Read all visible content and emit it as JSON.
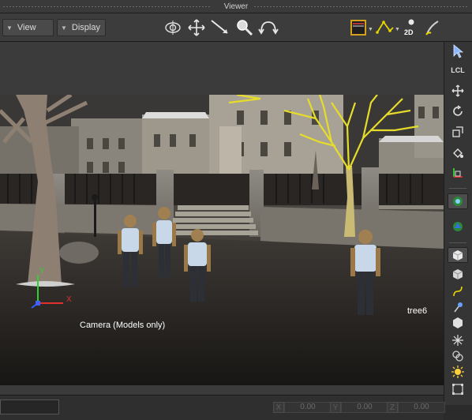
{
  "window": {
    "title": "Viewer"
  },
  "toolbar": {
    "view_menu": "View",
    "display_menu": "Display",
    "icons": [
      "orbit-icon",
      "pan-icon",
      "dolly-icon",
      "zoom-icon",
      "undo-camera-icon",
      "safe-area-icon",
      "curve-icon",
      "2d-view-icon",
      "brush-icon"
    ],
    "label_2d": "2D"
  },
  "viewport": {
    "camera_label": "Camera (Models only)",
    "selected_object_label": "tree6",
    "axis": {
      "x": "X",
      "y": "Y"
    }
  },
  "right_toolbar": {
    "icons": [
      "select-arrow-icon",
      "local-mode-icon",
      "move-icon",
      "rotate-icon",
      "scale-icon",
      "paint-bucket-icon",
      "translate-gizmo-icon",
      "snap-icon",
      "display-icon",
      "cube-solid-icon",
      "cube-icon",
      "spline-icon",
      "pin-icon",
      "hexagon-icon",
      "joint-icon",
      "knot-icon",
      "light-icon",
      "bounding-box-icon"
    ],
    "local_label": "LCL"
  },
  "statusbar": {
    "field_value": "",
    "coords": [
      {
        "axis": "X",
        "value": "0.00"
      },
      {
        "axis": "Y",
        "value": "0.00"
      },
      {
        "axis": "Z",
        "value": "0.00"
      }
    ]
  }
}
